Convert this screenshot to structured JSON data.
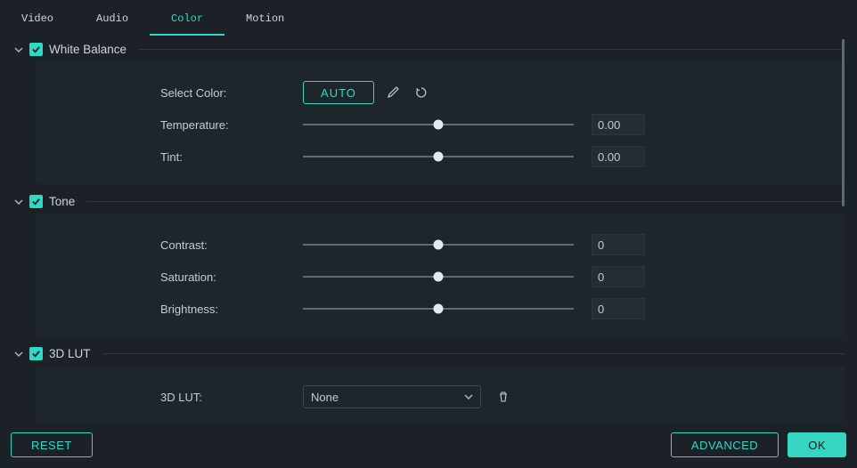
{
  "tabs": {
    "video": "Video",
    "audio": "Audio",
    "color": "Color",
    "motion": "Motion",
    "active": "color"
  },
  "sections": {
    "white_balance": {
      "title": "White Balance",
      "select_color_label": "Select Color:",
      "auto_button": "AUTO",
      "temperature_label": "Temperature:",
      "temperature_value": "0.00",
      "tint_label": "Tint:",
      "tint_value": "0.00"
    },
    "tone": {
      "title": "Tone",
      "contrast_label": "Contrast:",
      "contrast_value": "0",
      "saturation_label": "Saturation:",
      "saturation_value": "0",
      "brightness_label": "Brightness:",
      "brightness_value": "0"
    },
    "lut": {
      "title": "3D LUT",
      "lut_label": "3D LUT:",
      "lut_selected": "None"
    }
  },
  "footer": {
    "reset": "RESET",
    "advanced": "ADVANCED",
    "ok": "OK"
  }
}
